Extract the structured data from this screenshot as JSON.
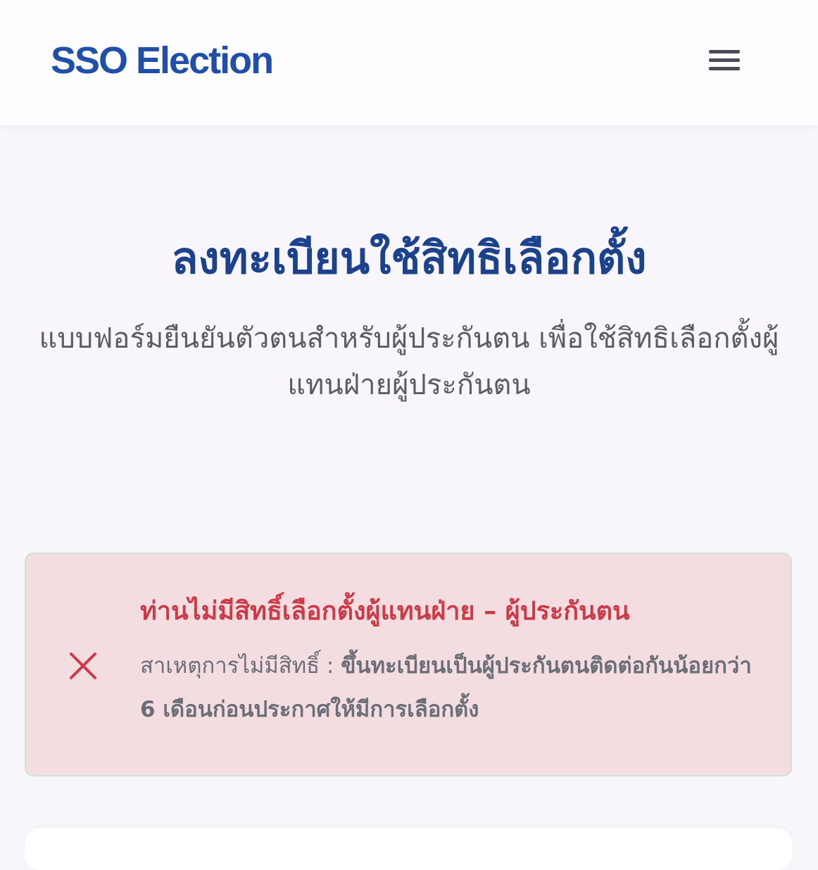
{
  "header": {
    "brand": "SSO Election",
    "menu_icon": "hamburger-menu-icon"
  },
  "hero": {
    "title": "ลงทะเบียนใช้สิทธิเลือกตั้ง",
    "subtitle": "แบบฟอร์มยืนยันตัวตนสำหรับผู้ประกันตน เพื่อใช้สิทธิเลือกตั้งผู้แทนฝ่ายผู้ประกันตน"
  },
  "alert": {
    "icon": "close-x-icon",
    "title": "ท่านไม่มีสิทธิ์เลือกตั้งผู้แทนฝ่าย – ผู้ประกันตน",
    "reason_label": "สาเหตุการไม่มีสิทธิ์ : ",
    "reason_text": "ขึ้นทะเบียนเป็นผู้ประกันตนติดต่อกันน้อยกว่า 6 เดือนก่อนประกาศให้มีการเลือกตั้ง",
    "accent_color": "#cc3a47",
    "background_color": "#f3dde0"
  }
}
